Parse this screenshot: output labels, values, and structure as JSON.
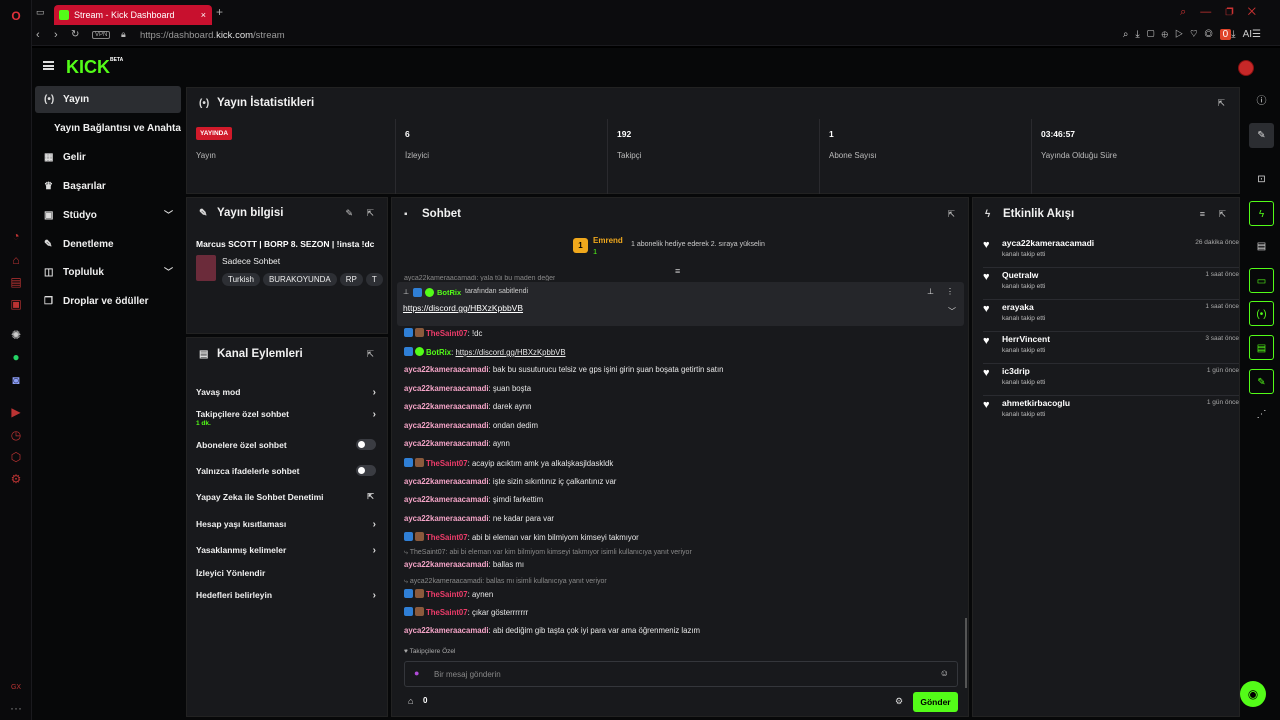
{
  "browser": {
    "tab_title": "Stream - Kick Dashboard",
    "url_prefix": "https://dashboard.",
    "url_domain": "kick.com",
    "url_path": "/stream",
    "vpn": "VPN",
    "ai_label": "AI",
    "notif_count": "0"
  },
  "app": {
    "logo": "KICK",
    "logo_sup": "BETA"
  },
  "sidebar": {
    "items": [
      {
        "label": "Yayın"
      },
      {
        "label": "Yayın Bağlantısı ve Anahtarı"
      },
      {
        "label": "Gelir"
      },
      {
        "label": "Başarılar"
      },
      {
        "label": "Stüdyo"
      },
      {
        "label": "Denetleme"
      },
      {
        "label": "Topluluk"
      },
      {
        "label": "Droplar ve ödüller"
      }
    ]
  },
  "stats": {
    "title": "Yayın İstatistikleri",
    "live_badge": "YAYINDA",
    "items": [
      {
        "value": "",
        "label": "Yayın"
      },
      {
        "value": "6",
        "label": "İzleyici"
      },
      {
        "value": "192",
        "label": "Takipçi"
      },
      {
        "value": "1",
        "label": "Abone Sayısı"
      },
      {
        "value": "03:46:57",
        "label": "Yayında Olduğu Süre"
      }
    ]
  },
  "stream_info": {
    "title": "Yayın bilgisi",
    "stream_title": "Marcus SCOTT | BORP 8. SEZON | !insta !dc",
    "category": "Sadece Sohbet",
    "tags": [
      "Turkish",
      "BURAKOYUNDA",
      "RP",
      "T"
    ]
  },
  "channel_actions": {
    "title": "Kanal Eylemleri",
    "rows": [
      {
        "label": "Yavaş mod",
        "sub": ""
      },
      {
        "label": "Takipçilere özel sohbet",
        "sub": "1 dk."
      },
      {
        "label": "Abonelere özel sohbet",
        "sub": ""
      },
      {
        "label": "Yalnızca ifadelerle sohbet",
        "sub": ""
      },
      {
        "label": "Yapay Zeka ile Sohbet Denetimi",
        "sub": ""
      },
      {
        "label": "Hesap yaşı kısıtlaması",
        "sub": ""
      },
      {
        "label": "Yasaklanmış kelimeler",
        "sub": ""
      },
      {
        "label": "İzleyici Yönlendir",
        "sub": ""
      },
      {
        "label": "Hedefleri belirleyin",
        "sub": ""
      }
    ]
  },
  "chat": {
    "title": "Sohbet",
    "promo_name": "Emrend",
    "promo_count": "1",
    "promo_rank": "1",
    "promo_text": "1 abonelik hediye ederek 2. sıraya yükselin",
    "cut_line": "ayca22kameraacamadi: yala tüi bu maden değer",
    "pinned_by": "BotRix",
    "pinned_suffix": "tarafından sabitlendi",
    "pinned_link": "https://discord.gg/HBXzKpbbVB",
    "messages": [
      {
        "user": "TheSaint07",
        "text": "!dc"
      },
      {
        "user": "BotRix",
        "text": "https://discord.gg/HBXzKpbbVB"
      },
      {
        "user": "ayca22kameraacamadi",
        "text": "bak bu susuturucu telsiz ve gps işini girin şuan boşata getirtin satın"
      },
      {
        "user": "ayca22kameraacamadi",
        "text": "şuan boşta"
      },
      {
        "user": "ayca22kameraacamadi",
        "text": "darek aynn"
      },
      {
        "user": "ayca22kameraacamadi",
        "text": "ondan dedim"
      },
      {
        "user": "ayca22kameraacamadi",
        "text": "aynn"
      },
      {
        "user": "TheSaint07",
        "text": "acayip acıktım amk ya alkalşkasjldaskldk"
      },
      {
        "user": "ayca22kameraacamadi",
        "text": "işte sizin sıkıntınız iç çalkantınız var"
      },
      {
        "user": "ayca22kameraacamadi",
        "text": "şimdi farkettim"
      },
      {
        "user": "ayca22kameraacamadi",
        "text": "ne kadar para var"
      },
      {
        "user": "TheSaint07",
        "text": "abi bi eleman var kim bilmiyom kimseyi takmıyor"
      },
      {
        "reply": "TheSaint07: abi bi eleman var kim bilmiyom kimseyi takmıyor isimli kullanıcıya yanıt veriyor"
      },
      {
        "user": "ayca22kameraacamadi",
        "text": "ballas mı"
      },
      {
        "reply": "ayca22kameraacamadi: ballas mı isimli kullanıcıya yanıt veriyor"
      },
      {
        "user": "TheSaint07",
        "text": "aynen"
      },
      {
        "user": "TheSaint07",
        "text": "çıkar gösterrrrrrr"
      },
      {
        "user": "ayca22kameraacamadi",
        "text": "abi dediğim gib taşta çok iyi para var ama öğrenmeniz lazım"
      }
    ],
    "followers_only": "Takipçilere Özel",
    "input_placeholder": "Bir mesaj gönderin",
    "points": "0",
    "send": "Gönder"
  },
  "events": {
    "title": "Etkinlik Akışı",
    "items": [
      {
        "name": "ayca22kameraacamadi",
        "action": "kanalı takip etti",
        "time": "26 dakika önce"
      },
      {
        "name": "Quetralw",
        "action": "kanalı takip etti",
        "time": "1 saat önce"
      },
      {
        "name": "erayaka",
        "action": "kanalı takip etti",
        "time": "1 saat önce"
      },
      {
        "name": "HerrVincent",
        "action": "kanalı takip etti",
        "time": "3 saat önce"
      },
      {
        "name": "ic3drip",
        "action": "kanalı takip etti",
        "time": "1 gün önce"
      },
      {
        "name": "ahmetkirbacoglu",
        "action": "kanalı takip etti",
        "time": "1 gün önce"
      }
    ]
  },
  "colors": {
    "brand": "#53fc18",
    "live": "#d11a2a",
    "panel": "#18191c"
  }
}
